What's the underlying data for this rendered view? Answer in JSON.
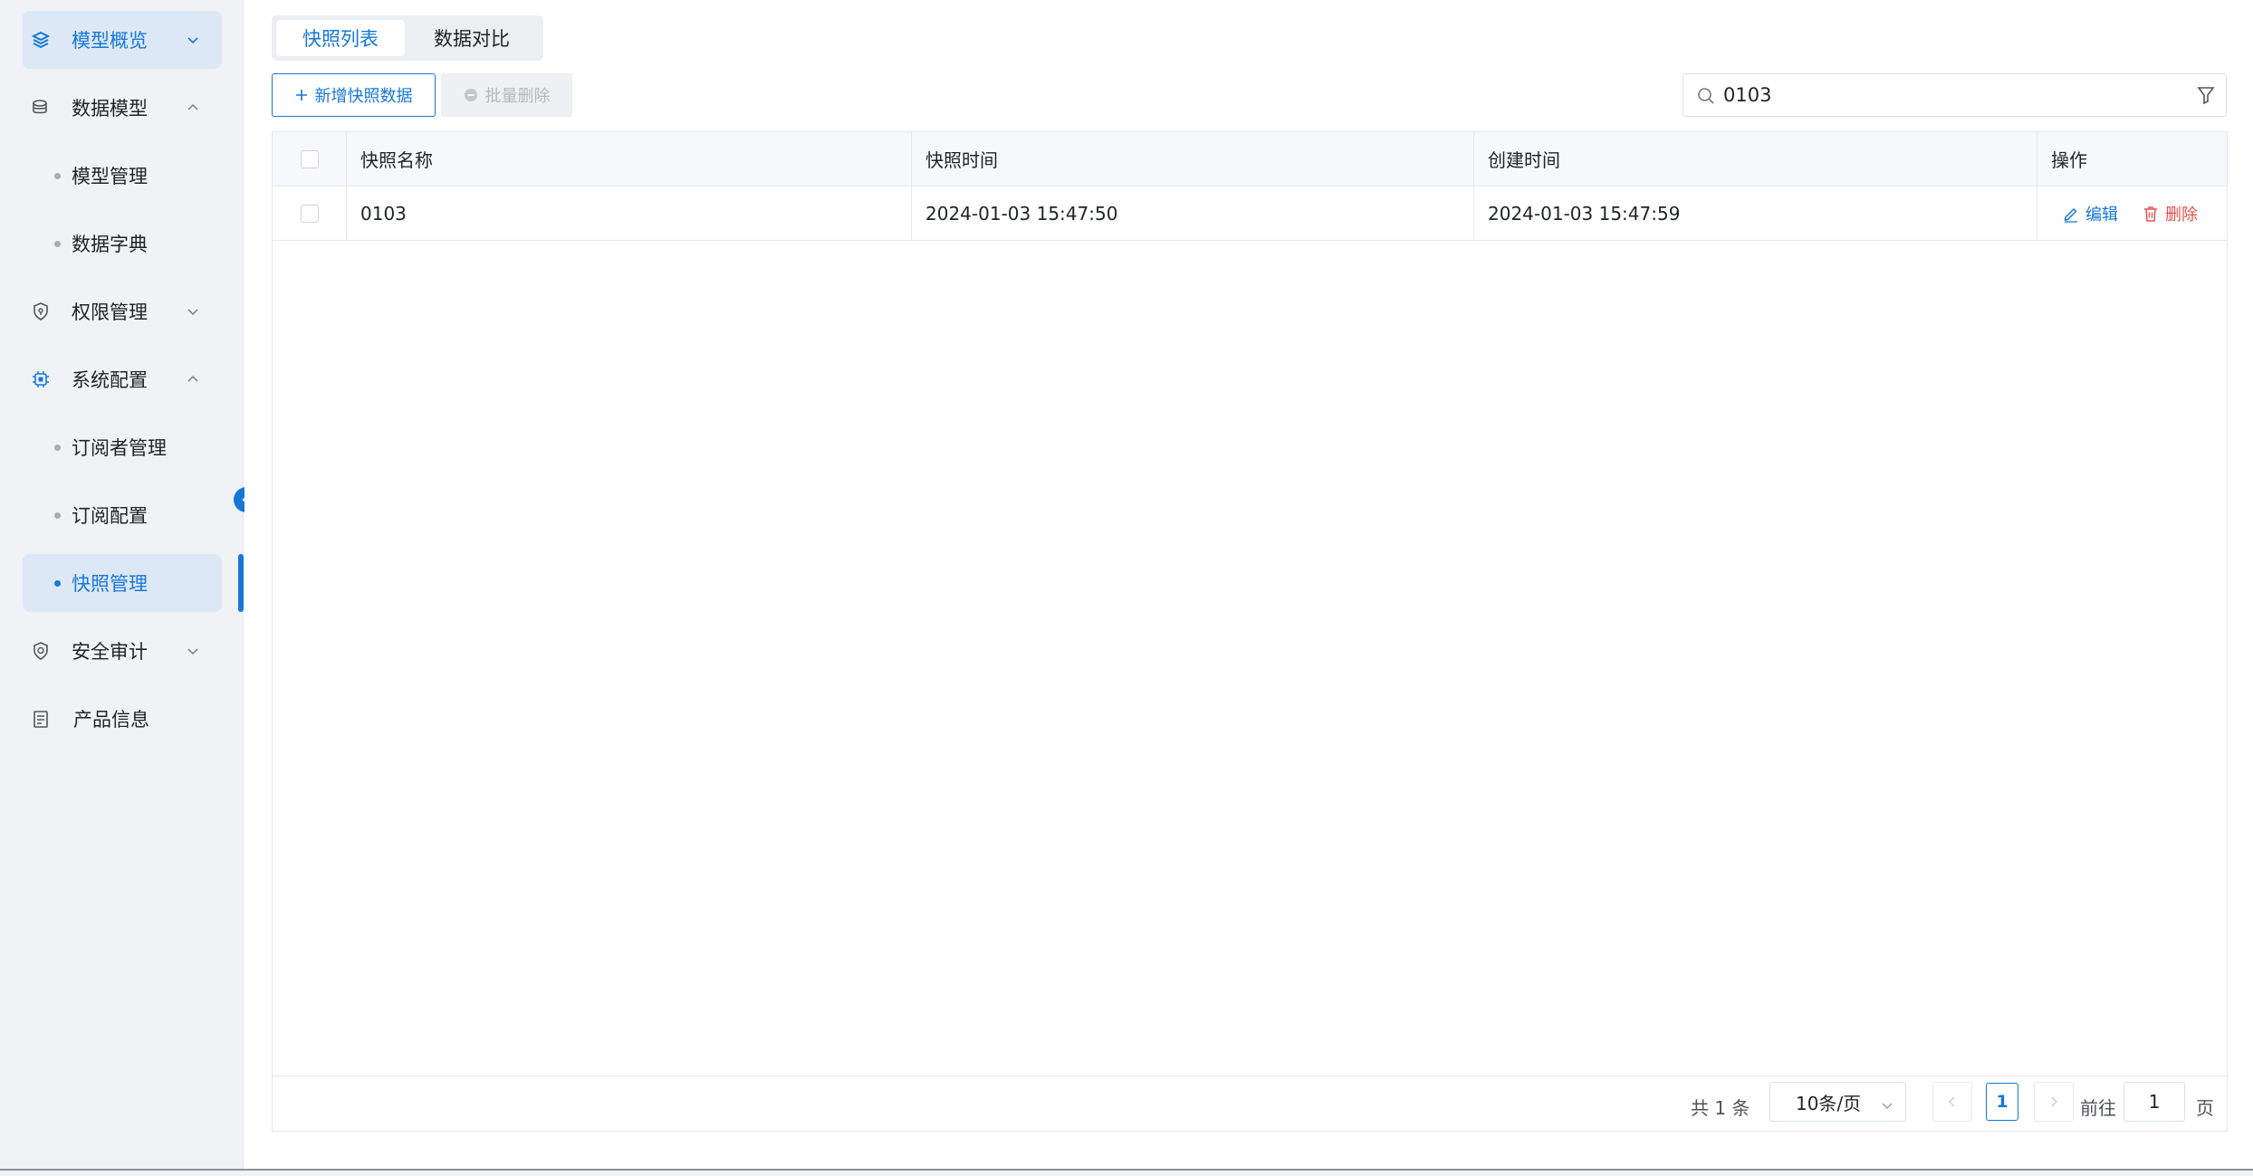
{
  "sidebar": {
    "items": [
      {
        "label": "模型概览",
        "icon": "layers-icon"
      },
      {
        "label": "数据模型",
        "icon": "database-icon"
      },
      {
        "label": "模型管理"
      },
      {
        "label": "数据字典"
      },
      {
        "label": "权限管理",
        "icon": "shield-lock-icon"
      },
      {
        "label": "系统配置",
        "icon": "chip-icon"
      },
      {
        "label": "订阅者管理"
      },
      {
        "label": "订阅配置"
      },
      {
        "label": "快照管理"
      },
      {
        "label": "安全审计",
        "icon": "shield-check-icon"
      },
      {
        "label": "产品信息",
        "icon": "document-icon"
      }
    ]
  },
  "tabs": [
    {
      "label": "快照列表",
      "active": true
    },
    {
      "label": "数据对比",
      "active": false
    }
  ],
  "toolbar": {
    "add_label": "新增快照数据",
    "batch_delete_label": "批量删除"
  },
  "search": {
    "value": "0103"
  },
  "table": {
    "headers": [
      "快照名称",
      "快照时间",
      "创建时间",
      "操作"
    ],
    "rows": [
      {
        "name": "0103",
        "snapshot_time": "2024-01-03 15:47:50",
        "created_time": "2024-01-03 15:47:59"
      }
    ],
    "actions": {
      "edit": "编辑",
      "delete": "删除"
    }
  },
  "pagination": {
    "total_text": "共 1 条",
    "page_size": "10条/页",
    "current_page": "1",
    "goto_label": "前往",
    "goto_value": "1",
    "page_suffix": "页"
  },
  "colors": {
    "accent": "#1677d9",
    "danger": "#e8504f",
    "sidebar_bg": "#f0f2f5",
    "active_bg": "#dde8f6"
  }
}
